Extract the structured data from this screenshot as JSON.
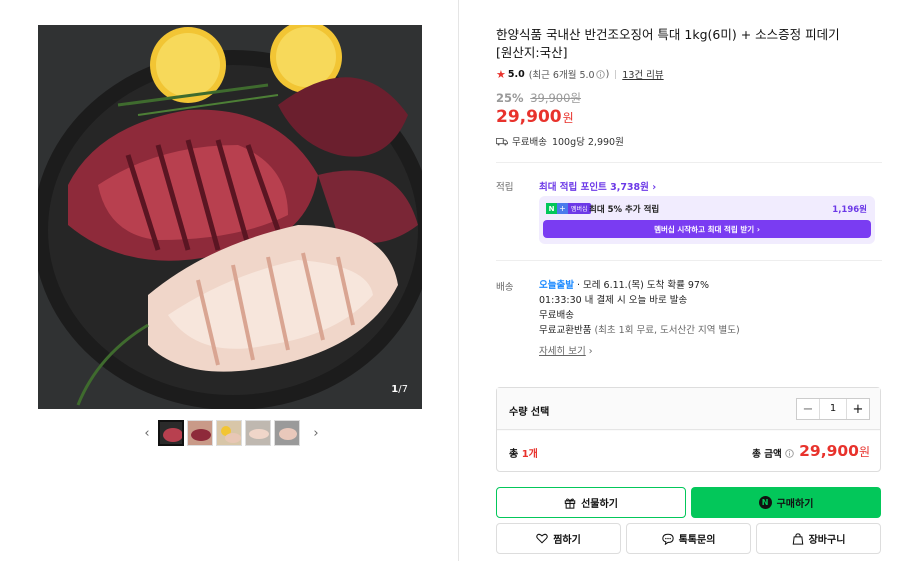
{
  "product": {
    "title_line1": "한양식품 국내산 반건조오징어 특대 1kg(6미) + 소스증정 피데기",
    "title_line2": "[원산지:국산]",
    "rating": "5.0",
    "rating_note": "(최근 6개월 5.0",
    "rating_note_close": ")",
    "review_link": "13건 리뷰",
    "discount_rate": "25%",
    "original_price": "39,900원",
    "price": "29,900",
    "price_unit": "원",
    "shipping": "무료배송",
    "unit_price": "100g당 2,990원"
  },
  "gallery": {
    "counter_current": "1",
    "counter_total": "/7",
    "prev_arrow": "‹",
    "next_arrow": "›"
  },
  "points": {
    "label": "적립",
    "headline": "최대 적립 포인트 3,738원 ›",
    "badge_n": "N",
    "badge_plus": "+",
    "badge_tag": "멤버십",
    "box_text": "최대 5% 추가 적립",
    "box_amount": "1,196원",
    "cta": "멤버십 시작하고 최대 적립 받기 ›"
  },
  "delivery": {
    "label": "배송",
    "today": "오늘출발",
    "eta": " · 모레 6.11.(목) 도착 확률 97%",
    "line2": "01:33:30 내 결제 시 오늘 바로 발송",
    "line3": "무료배송",
    "line4_main": "무료교환반품",
    "line4_note": " (최초 1회 무료, 도서산간 지역 별도)",
    "detail": "자세히 보기",
    "detail_arrow": " ›"
  },
  "quantity": {
    "label": "수량 선택",
    "minus": "−",
    "value": "1",
    "plus": "+",
    "total_prefix": "총 ",
    "total_count": "1개",
    "total_label": "총 금액",
    "total_price": "29,900",
    "total_unit": "원"
  },
  "buttons": {
    "gift": "선물하기",
    "buy": "구매하기",
    "buy_badge": "N",
    "wish": "찜하기",
    "talk": "톡톡문의",
    "cart": "장바구니"
  },
  "colors": {
    "accent_red": "#e8322c",
    "naver_green": "#03c75a",
    "membership_purple": "#7a3cf2"
  }
}
